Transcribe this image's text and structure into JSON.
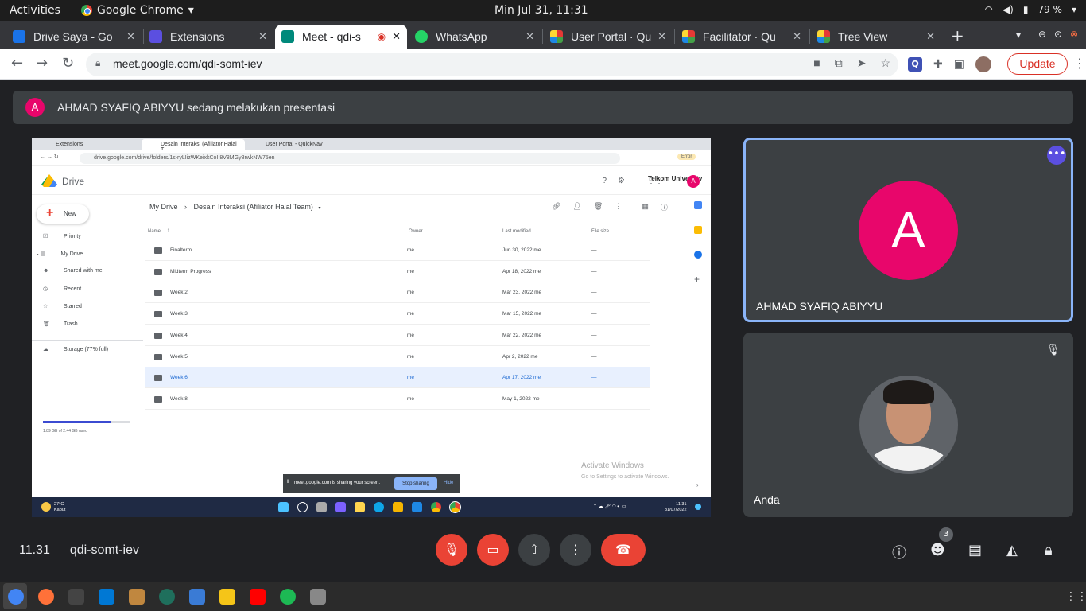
{
  "topbar": {
    "activities": "Activities",
    "app": "Google Chrome",
    "clock": "Min Jul 31, 11:31",
    "battery": "79 %"
  },
  "tabs": [
    {
      "label": "Drive Saya - Go",
      "color": "#1a73e8"
    },
    {
      "label": "Extensions",
      "color": "#5b4fe0"
    },
    {
      "label": "Meet - qdi-s",
      "color": "#00897b"
    },
    {
      "label": "WhatsApp",
      "color": "#25d366"
    },
    {
      "label": "User Portal · Qu",
      "color": "#e53935"
    },
    {
      "label": "Facilitator · Qu",
      "color": "#e53935"
    },
    {
      "label": "Tree View",
      "color": "#e53935"
    }
  ],
  "url": "meet.google.com/qdi-somt-iev",
  "update_label": "Update",
  "banner": {
    "avatar": "A",
    "text": "AHMAD SYAFIQ ABIYYU sedang melakukan presentasi"
  },
  "shared": {
    "tabs": [
      "Extensions",
      "Desain Interaksi (Afiliator Halal T...",
      "User Portal - QuickNav"
    ],
    "url": "drive.google.com/drive/folders/1s-ryLIizWKeixkCoI.8V8MGy8rwkNW75en",
    "error": "Error",
    "drive_title": "Drive",
    "telkom": "Telkom University",
    "avatar": "A",
    "new_label": "New",
    "nav": [
      "Priority",
      "My Drive",
      "Shared with me",
      "Recent",
      "Starred",
      "Trash",
      "Storage (77% full)"
    ],
    "storage_text": "1.89 GB of 2.44 GB used",
    "storage_fraction": 0.77,
    "breadcrumb_root": "My Drive",
    "breadcrumb_folder": "Desain Interaksi (Afiliator Halal Team)",
    "columns": [
      "Name",
      "Owner",
      "Last modified",
      "File size"
    ],
    "rows": [
      {
        "name": "Finalterm",
        "owner": "me",
        "modified": "Jun 30, 2022",
        "by": "me",
        "size": "—"
      },
      {
        "name": "Midterm Progress",
        "owner": "me",
        "modified": "Apr 18, 2022",
        "by": "me",
        "size": "—"
      },
      {
        "name": "Week 2",
        "owner": "me",
        "modified": "Mar 23, 2022",
        "by": "me",
        "size": "—"
      },
      {
        "name": "Week 3",
        "owner": "me",
        "modified": "Mar 15, 2022",
        "by": "me",
        "size": "—"
      },
      {
        "name": "Week 4",
        "owner": "me",
        "modified": "Mar 22, 2022",
        "by": "me",
        "size": "—"
      },
      {
        "name": "Week 5",
        "owner": "me",
        "modified": "Apr 2, 2022",
        "by": "me",
        "size": "—"
      },
      {
        "name": "Week 6",
        "owner": "me",
        "modified": "Apr 17, 2022",
        "by": "me",
        "size": "—"
      },
      {
        "name": "Week 8",
        "owner": "me",
        "modified": "May 1, 2022",
        "by": "me",
        "size": "—"
      }
    ],
    "activate_title": "Activate Windows",
    "activate_sub": "Go to Settings to activate Windows.",
    "sharing_text": "meet.google.com is sharing your screen.",
    "stop_sharing": "Stop sharing",
    "hide": "Hide",
    "weather_temp": "27°C",
    "weather_desc": "Kabut",
    "taskbar_time": "11:31",
    "taskbar_date": "31/07/2022"
  },
  "participants": [
    {
      "name": "AHMAD SYAFIQ ABIYYU",
      "avatar": "A"
    },
    {
      "name": "Anda"
    }
  ],
  "meeting": {
    "time": "11.31",
    "code": "qdi-somt-iev",
    "participant_count": "3"
  },
  "dock_colors": [
    "#4285f4",
    "#ff7139",
    "#444",
    "#0078d4",
    "#c0873f",
    "#1f6f5c",
    "#3a7bd5",
    "#f5c518",
    "#ff0000",
    "#1db954",
    "#888"
  ]
}
